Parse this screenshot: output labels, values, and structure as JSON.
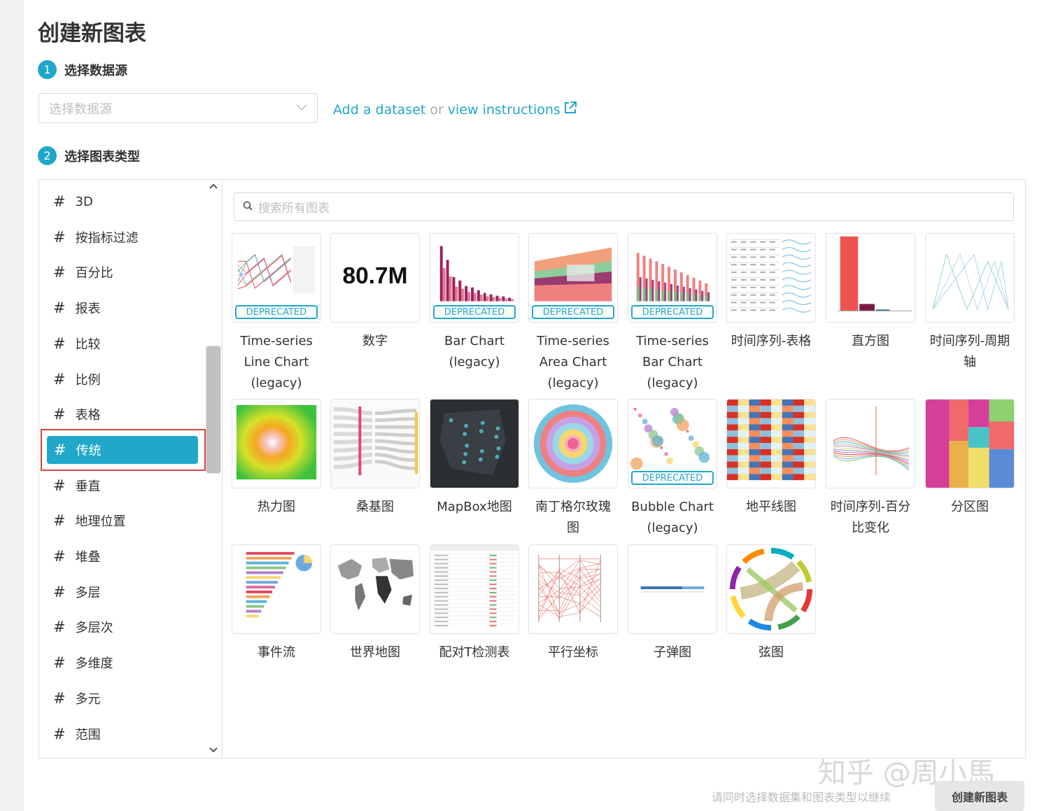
{
  "page": {
    "title": "创建新图表"
  },
  "steps": [
    {
      "num": "1",
      "label": "选择数据源"
    },
    {
      "num": "2",
      "label": "选择图表类型"
    }
  ],
  "datasource": {
    "placeholder": "选择数据源",
    "add_link": "Add a dataset",
    "or": "or",
    "instructions_link": "view instructions"
  },
  "categories": [
    "3D",
    "按指标过滤",
    "百分比",
    "报表",
    "比较",
    "比例",
    "表格",
    "传统",
    "垂直",
    "地理位置",
    "堆叠",
    "多层",
    "多层次",
    "多维度",
    "多元",
    "范围"
  ],
  "selected_category": "传统",
  "search": {
    "placeholder": "搜索所有图表"
  },
  "deprecated_label": "DEPRECATED",
  "charts": [
    {
      "name": "Time-series Line Chart (legacy)",
      "lines": [
        "Time-series",
        "Line Chart",
        "(legacy)"
      ],
      "deprecated": true
    },
    {
      "name": "数字",
      "lines": [
        "数字"
      ],
      "deprecated": false,
      "big_number": "80.7M"
    },
    {
      "name": "Bar Chart (legacy)",
      "lines": [
        "Bar Chart",
        "(legacy)"
      ],
      "deprecated": true
    },
    {
      "name": "Time-series Area Chart (legacy)",
      "lines": [
        "Time-series",
        "Area Chart",
        "(legacy)"
      ],
      "deprecated": true
    },
    {
      "name": "Time-series Bar Chart (legacy)",
      "lines": [
        "Time-series",
        "Bar Chart",
        "(legacy)"
      ],
      "deprecated": true
    },
    {
      "name": "时间序列-表格",
      "lines": [
        "时间序列-表格"
      ],
      "deprecated": false
    },
    {
      "name": "直方图",
      "lines": [
        "直方图"
      ],
      "deprecated": false
    },
    {
      "name": "时间序列-周期轴",
      "lines": [
        "时间序列-周期",
        "轴"
      ],
      "deprecated": false
    },
    {
      "name": "热力图",
      "lines": [
        "热力图"
      ],
      "deprecated": false
    },
    {
      "name": "桑基图",
      "lines": [
        "桑基图"
      ],
      "deprecated": false
    },
    {
      "name": "MapBox地图",
      "lines": [
        "MapBox地图"
      ],
      "deprecated": false
    },
    {
      "name": "南丁格尔玫瑰图",
      "lines": [
        "南丁格尔玫瑰",
        "图"
      ],
      "deprecated": false
    },
    {
      "name": "Bubble Chart (legacy)",
      "lines": [
        "Bubble Chart",
        "(legacy)"
      ],
      "deprecated": true
    },
    {
      "name": "地平线图",
      "lines": [
        "地平线图"
      ],
      "deprecated": false
    },
    {
      "name": "时间序列-百分比变化",
      "lines": [
        "时间序列-百分",
        "比变化"
      ],
      "deprecated": false
    },
    {
      "name": "分区图",
      "lines": [
        "分区图"
      ],
      "deprecated": false
    },
    {
      "name": "事件流",
      "lines": [
        "事件流"
      ],
      "deprecated": false
    },
    {
      "name": "世界地图",
      "lines": [
        "世界地图"
      ],
      "deprecated": false
    },
    {
      "name": "配对T检测表",
      "lines": [
        "配对T检测表"
      ],
      "deprecated": false
    },
    {
      "name": "平行坐标",
      "lines": [
        "平行坐标"
      ],
      "deprecated": false
    },
    {
      "name": "子弹图",
      "lines": [
        "子弹图"
      ],
      "deprecated": false
    },
    {
      "name": "弦图",
      "lines": [
        "弦图"
      ],
      "deprecated": false
    }
  ],
  "footer": {
    "hint": "请同时选择数据集和图表类型以继续",
    "create_button": "创建新图表"
  },
  "watermark": "知乎 @周小馬",
  "colors": {
    "accent": "#20a7c9",
    "selection_frame": "#d6463f"
  }
}
